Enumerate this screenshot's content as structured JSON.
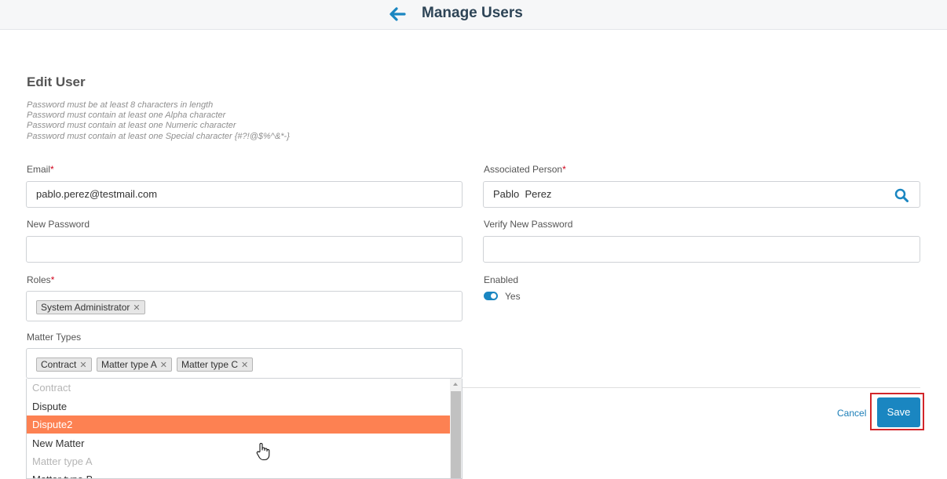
{
  "header": {
    "title": "Manage Users",
    "back_icon": "arrow-left-icon",
    "accent": "#1a86c1"
  },
  "form": {
    "title": "Edit User",
    "password_rules": [
      "Password must be at least 8 characters in length",
      "Password must contain at least one Alpha character",
      "Password must contain at least one Numeric character",
      "Password must contain at least one Special character {#?!@$%^&*-}"
    ],
    "email": {
      "label": "Email",
      "required_mark": "*",
      "value": "pablo.perez@testmail.com"
    },
    "associated_person": {
      "label": "Associated Person",
      "required_mark": "*",
      "value": "Pablo  Perez",
      "icon": "search-icon"
    },
    "new_password": {
      "label": "New Password",
      "value": ""
    },
    "verify_password": {
      "label": "Verify New Password",
      "value": ""
    },
    "roles": {
      "label": "Roles",
      "required_mark": "*",
      "tags": [
        "System Administrator"
      ]
    },
    "enabled": {
      "label": "Enabled",
      "value_label": "Yes",
      "on": true
    },
    "matter_types": {
      "label": "Matter Types",
      "tags": [
        "Contract",
        "Matter type A",
        "Matter type C"
      ],
      "options": [
        {
          "label": "Contract",
          "state": "disabled"
        },
        {
          "label": "Dispute",
          "state": "normal"
        },
        {
          "label": "Dispute2",
          "state": "highlighted"
        },
        {
          "label": "New Matter",
          "state": "normal"
        },
        {
          "label": "Matter type A",
          "state": "disabled"
        },
        {
          "label": "Matter type B",
          "state": "normal"
        }
      ]
    }
  },
  "actions": {
    "cancel_label": "Cancel",
    "save_label": "Save"
  },
  "colors": {
    "highlight": "#fd8152",
    "required": "#d0021b",
    "save_outline": "#d2262b"
  }
}
